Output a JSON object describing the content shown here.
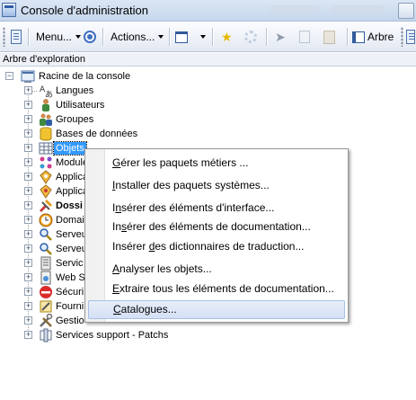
{
  "window": {
    "title": "Console d'administration"
  },
  "toolbar": {
    "menu_label": "Menu...",
    "actions_label": "Actions...",
    "tree_label": "Arbre"
  },
  "explorer": {
    "label": "Arbre d'exploration",
    "root_label": "Racine de la console",
    "nodes": [
      {
        "label": "Langues",
        "icon": "languages-icon"
      },
      {
        "label": "Utilisateurs",
        "icon": "user-icon"
      },
      {
        "label": "Groupes",
        "icon": "group-icon"
      },
      {
        "label": "Bases de données",
        "icon": "database-icon"
      },
      {
        "label": "Objets",
        "icon": "table-icon",
        "selected": true
      },
      {
        "label": "Module",
        "icon": "modules-icon"
      },
      {
        "label": "Applica",
        "icon": "application-icon"
      },
      {
        "label": "Applica",
        "icon": "application-icon"
      },
      {
        "label": "Dossi",
        "icon": "folder-tools-icon",
        "bold": true
      },
      {
        "label": "Domai",
        "icon": "clock-icon"
      },
      {
        "label": "Serveu",
        "icon": "server-search-icon"
      },
      {
        "label": "Serveu",
        "icon": "server-search-icon"
      },
      {
        "label": "Servic",
        "icon": "service-icon"
      },
      {
        "label": "Web S",
        "icon": "web-service-icon"
      },
      {
        "label": "Sécuri",
        "icon": "security-stop-icon"
      },
      {
        "label": "Fourni",
        "icon": "provider-icon"
      },
      {
        "label": "Gestio",
        "icon": "tools-icon"
      },
      {
        "label": "Services support - Patchs",
        "icon": "patch-icon"
      }
    ]
  },
  "context_menu": {
    "items": [
      {
        "label": "Gérer les paquets métiers ...",
        "accel": "G"
      },
      {
        "label": "Installer des paquets systèmes...",
        "accel": "I"
      },
      {
        "label": "Insérer des éléments d'interface...",
        "accel": "n"
      },
      {
        "label": "Insérer des éléments de documentation...",
        "accel": "s"
      },
      {
        "label": "Insérer des dictionnaires de traduction...",
        "accel": "d"
      },
      {
        "label": "Analyser les objets...",
        "accel": "A"
      },
      {
        "label": "Extraire tous les éléments de documentation...",
        "accel": "E"
      },
      {
        "label": "Catalogues...",
        "accel": "C",
        "highlighted": true
      }
    ]
  },
  "colors": {
    "selection": "#3399ff",
    "menu_highlight": "#d4e0f5",
    "titlebar": "#c6d7ec"
  }
}
